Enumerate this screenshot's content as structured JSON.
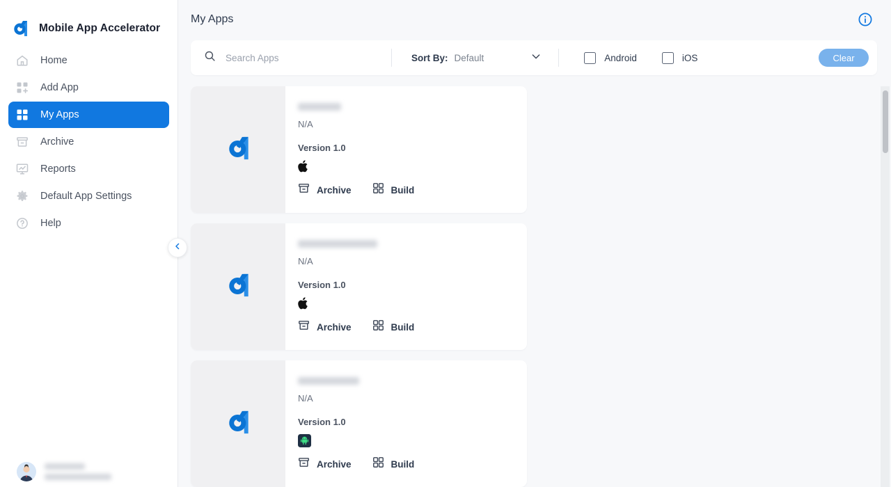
{
  "brand": {
    "title": "Mobile App Accelerator",
    "logo_icon": "accelerator-logo-icon"
  },
  "sidebar": {
    "items": [
      {
        "label": "Home",
        "icon": "home-icon",
        "active": false
      },
      {
        "label": "Add App",
        "icon": "add-app-grid-icon",
        "active": false
      },
      {
        "label": "My Apps",
        "icon": "grid-icon",
        "active": true
      },
      {
        "label": "Archive",
        "icon": "archive-box-icon",
        "active": false
      },
      {
        "label": "Reports",
        "icon": "reports-chart-icon",
        "active": false
      },
      {
        "label": "Default App Settings",
        "icon": "gear-icon",
        "active": false
      },
      {
        "label": "Help",
        "icon": "help-circle-icon",
        "active": false
      }
    ],
    "collapse_icon": "chevron-left-icon",
    "user": {
      "avatar_icon": "user-avatar",
      "name": "",
      "email": ""
    }
  },
  "header": {
    "title": "My Apps",
    "info_icon": "info-circle-icon"
  },
  "toolbar": {
    "search_placeholder": "Search Apps",
    "search_value": "",
    "search_icon": "search-icon",
    "sort_label": "Sort By:",
    "sort_value": "Default",
    "sort_chevron_icon": "chevron-down-icon",
    "filters": [
      {
        "label": "Android",
        "checked": false
      },
      {
        "label": "iOS",
        "checked": false
      }
    ],
    "clear_label": "Clear"
  },
  "apps": [
    {
      "name": "",
      "subtitle": "N/A",
      "version": "Version 1.0",
      "platform": "ios",
      "platform_icon": "apple-icon",
      "thumb_icon": "accelerator-logo-icon",
      "archive_label": "Archive",
      "archive_icon": "archive-box-icon",
      "build_label": "Build",
      "build_icon": "grid-dots-icon"
    },
    {
      "name": "",
      "subtitle": "N/A",
      "version": "Version 1.0",
      "platform": "ios",
      "platform_icon": "apple-icon",
      "thumb_icon": "accelerator-logo-icon",
      "archive_label": "Archive",
      "archive_icon": "archive-box-icon",
      "build_label": "Build",
      "build_icon": "grid-dots-icon"
    },
    {
      "name": "",
      "subtitle": "N/A",
      "version": "Version 1.0",
      "platform": "android",
      "platform_icon": "android-icon",
      "thumb_icon": "accelerator-logo-icon",
      "archive_label": "Archive",
      "archive_icon": "archive-box-icon",
      "build_label": "Build",
      "build_icon": "grid-dots-icon"
    }
  ],
  "colors": {
    "accent": "#1178e0",
    "page_bg": "#f7f8fa",
    "clear_button": "#79b2ec",
    "android_green": "#3ddc84",
    "text_dark": "#2e3a4d"
  }
}
